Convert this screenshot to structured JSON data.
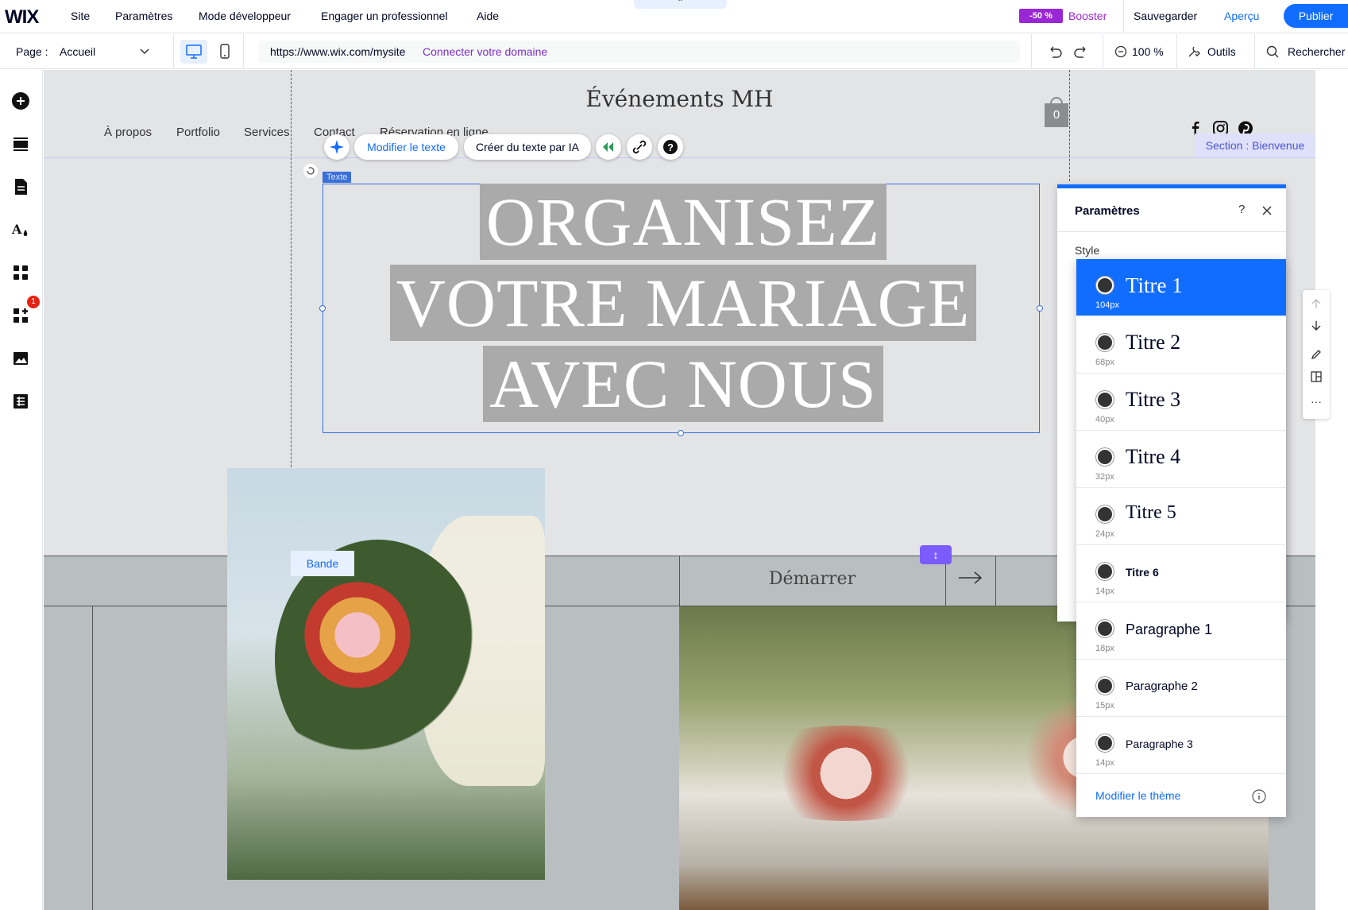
{
  "topbar": {
    "logo": "WIX",
    "menu": [
      "Site",
      "Paramètres",
      "Mode développeur",
      "Engager un professionnel",
      "Aide"
    ],
    "discount_badge": "-50 %",
    "booster": "Booster",
    "save": "Sauvegarder",
    "preview": "Aperçu",
    "publish": "Publier"
  },
  "subbar": {
    "page_label": "Page :",
    "page_value": "Accueil",
    "url": "https://www.wix.com/mysite",
    "connect_domain": "Connecter votre domaine",
    "zoom": "100 %",
    "tools": "Outils",
    "search": "Rechercher"
  },
  "leftbar": {
    "notification_count": "1",
    "icons": [
      "add-icon",
      "sections-icon",
      "pages-icon",
      "design-icon",
      "apps-icon",
      "app-market-icon",
      "media-icon",
      "cms-icon"
    ]
  },
  "site": {
    "title": "Événements MH",
    "cart_count": "0",
    "nav": [
      "À propos",
      "Portfolio",
      "Services",
      "Contact",
      "Réservation en ligne"
    ],
    "section_label": "Section : Bienvenue",
    "text_label": "Texte",
    "headline": [
      "ORGANISEZ",
      "VOTRE MARIAGE",
      "AVEC NOUS"
    ],
    "strip_label": "Bande",
    "cta": "Démarrer"
  },
  "text_toolbar": {
    "edit_text": "Modifier le texte",
    "ai_text": "Créer du texte par IA"
  },
  "panel": {
    "title": "Paramètres",
    "style_label": "Style",
    "footer_link": "Modifier le thème",
    "styles": [
      {
        "label": "Titre 1",
        "size": "104px",
        "selected": true
      },
      {
        "label": "Titre 2",
        "size": "68px"
      },
      {
        "label": "Titre 3",
        "size": "40px"
      },
      {
        "label": "Titre 4",
        "size": "32px"
      },
      {
        "label": "Titre 5",
        "size": "24px"
      },
      {
        "label": "Titre 6",
        "size": "14px"
      },
      {
        "label": "Paragraphe 1",
        "size": "18px"
      },
      {
        "label": "Paragraphe 2",
        "size": "15px"
      },
      {
        "label": "Paragraphe 3",
        "size": "14px"
      }
    ]
  },
  "colors": {
    "accent": "#116dff",
    "booster": "#9a27d5",
    "ai_purple": "#7b2fd1"
  }
}
